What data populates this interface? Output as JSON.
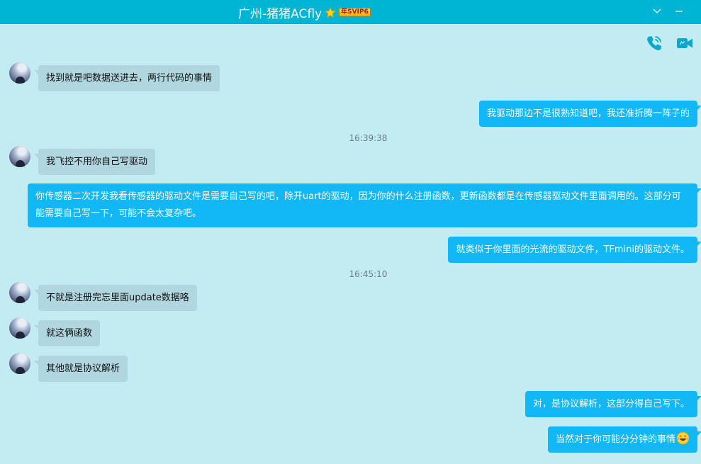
{
  "window": {
    "title": "广州-猪猪ACfly",
    "vip_badge": "年SVIP6"
  },
  "colors": {
    "titlebar": "#00b4d4",
    "background": "#c2ebf2",
    "incoming_bubble": "#b0d6df",
    "outgoing_bubble": "#12b7f5"
  },
  "messages": [
    {
      "dir": "in",
      "text": "找到就是吧数据送进去，两行代码的事情"
    },
    {
      "dir": "out",
      "text": "我驱动那边不是很熟知道吧，我还准折腾一阵子的"
    },
    {
      "time": "16:39:38"
    },
    {
      "dir": "in",
      "text": "我飞控不用你自己写驱动"
    },
    {
      "dir": "out",
      "text": "你传感器二次开发我看传感器的驱动文件是需要自己写的吧，除开uart的驱动，因为你的什么注册函数，更新函数都是在传感器驱动文件里面调用的。这部分可能需要自己写一下，可能不会太复杂吧。"
    },
    {
      "dir": "out",
      "text": "就类似于你里面的光流的驱动文件，TFmini的驱动文件。"
    },
    {
      "time": "16:45:10"
    },
    {
      "dir": "in",
      "text": "不就是注册完忘里面update数据咯"
    },
    {
      "dir": "in",
      "text": "就这俩函数"
    },
    {
      "dir": "in",
      "text": "其他就是协议解析"
    },
    {
      "dir": "out",
      "text": "对，是协议解析，这部分得自己写下。"
    },
    {
      "dir": "out",
      "text": "当然对于你可能分分钟的事情",
      "emoji": "laughing-tears-emoji"
    }
  ]
}
